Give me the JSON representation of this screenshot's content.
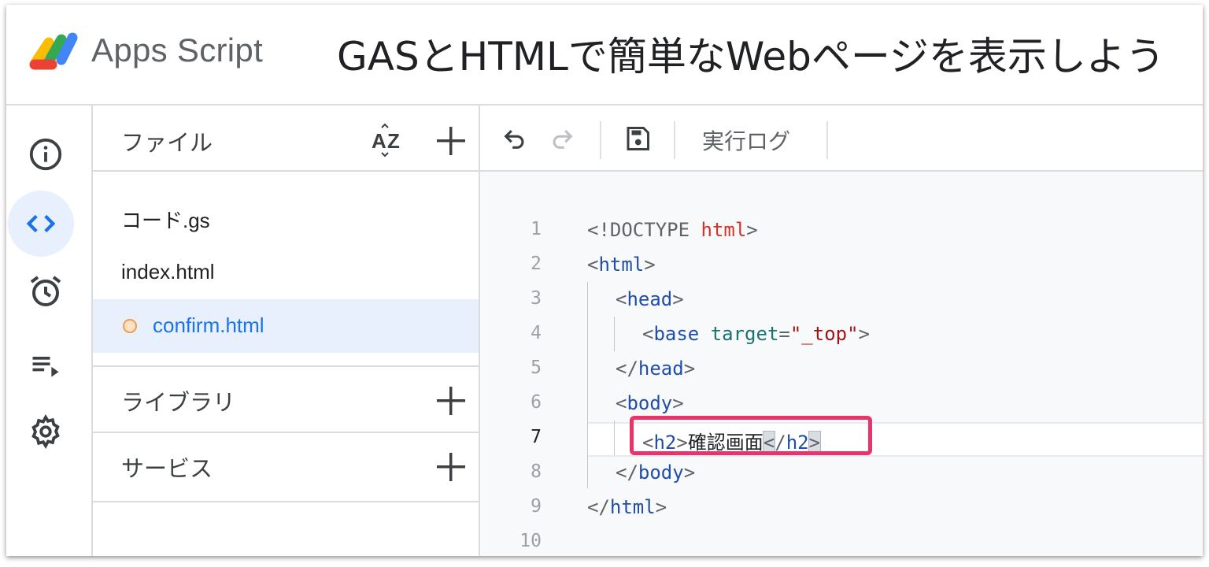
{
  "header": {
    "app_name": "Apps Script",
    "project_title": "GASとHTMLで簡単なWebページを表示しよう"
  },
  "rail": {
    "items": [
      "info-icon",
      "code-icon",
      "alarm-icon",
      "executions-icon",
      "settings-icon"
    ],
    "active": "code-icon"
  },
  "files": {
    "title": "ファイル",
    "items": [
      {
        "name": "コード.gs",
        "selected": false
      },
      {
        "name": "index.html",
        "selected": false
      },
      {
        "name": "confirm.html",
        "selected": true,
        "unsaved": true
      }
    ],
    "libraries_label": "ライブラリ",
    "services_label": "サービス"
  },
  "toolbar": {
    "log_label": "実行ログ"
  },
  "editor": {
    "current_line": 7,
    "lines": [
      {
        "n": "1",
        "indent": "",
        "doctype": "<!DOCTYPE ",
        "kw": "html",
        "end": ">"
      },
      {
        "n": "2",
        "lt": "<",
        "tag": "html",
        "gt": ">"
      },
      {
        "n": "3",
        "lt": "<",
        "tag": "head",
        "gt": ">"
      },
      {
        "n": "4",
        "lt": "<",
        "tag": "base",
        "attr": "target",
        "eq": "=",
        "str": "\"_top\"",
        "gt": ">"
      },
      {
        "n": "5",
        "lt": "</",
        "tag": "head",
        "gt": ">"
      },
      {
        "n": "6",
        "lt": "<",
        "tag": "body",
        "gt": ">"
      },
      {
        "n": "7",
        "lt": "<",
        "tag": "h2",
        "gt": ">",
        "text": "確認画面",
        "close_lt": "<",
        "close_slash": "/",
        "close_tag": "h2",
        "close_gt": ">"
      },
      {
        "n": "8",
        "lt": "</",
        "tag": "body",
        "gt": ">"
      },
      {
        "n": "9",
        "lt": "</",
        "tag": "html",
        "gt": ">"
      },
      {
        "n": "10"
      }
    ]
  },
  "colors": {
    "accent": "#1a73e8",
    "highlight_box": "#e8336b",
    "unsaved_dot": "#f09d4a"
  }
}
